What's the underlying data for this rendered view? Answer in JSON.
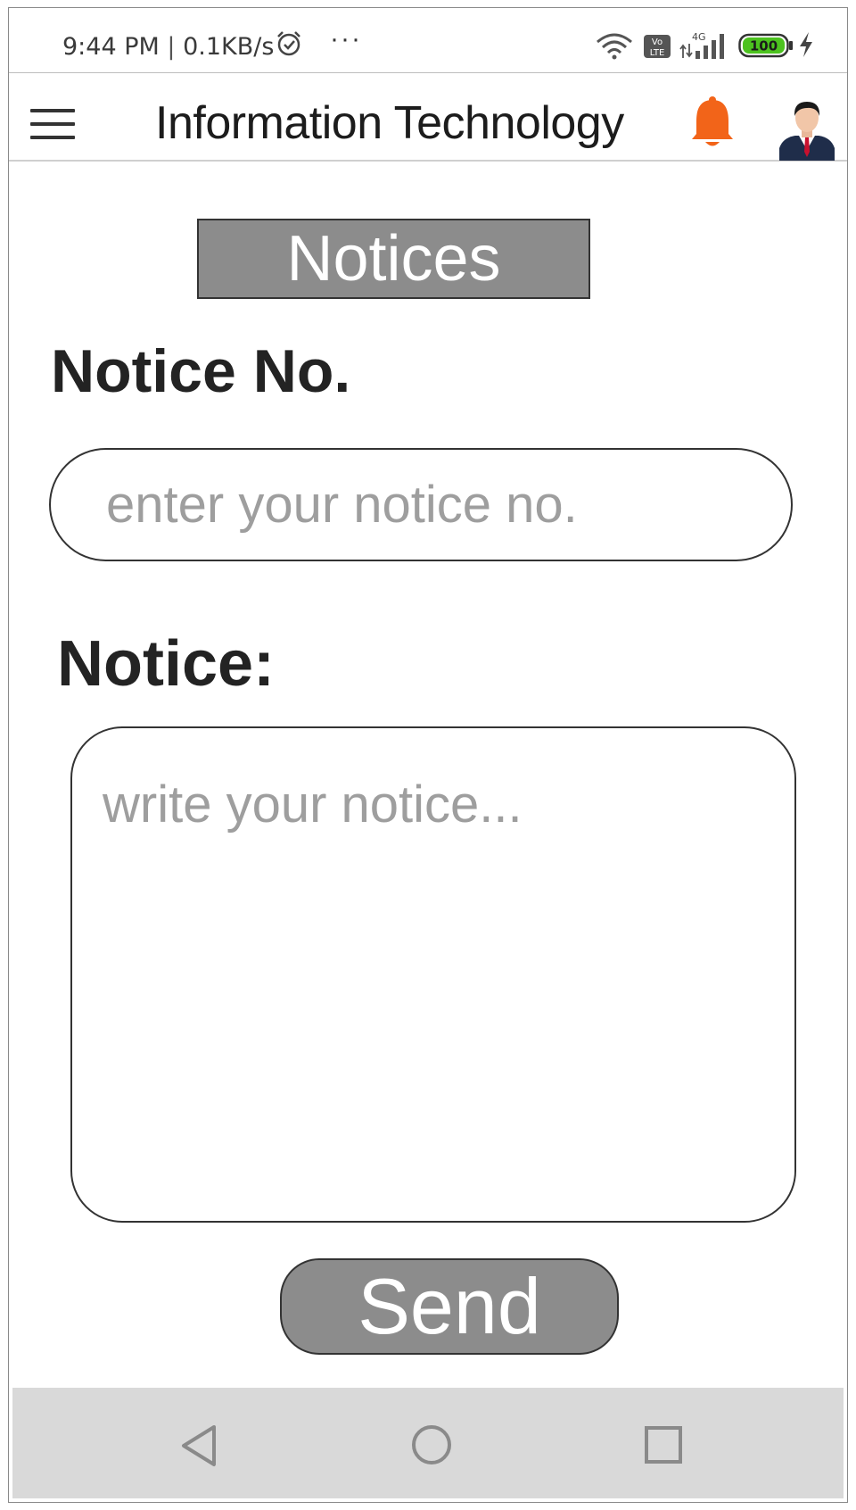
{
  "status_bar": {
    "time": "9:44 PM",
    "separator": "|",
    "speed": "0.1KB/s",
    "more": "···",
    "network": "4G",
    "volte": "Vo LTE",
    "battery": "100"
  },
  "app_bar": {
    "title": "Information Technology"
  },
  "page": {
    "header": "Notices",
    "notice_no_label": "Notice No.",
    "notice_no_placeholder": "enter your notice no.",
    "notice_no_value": "",
    "notice_label": "Notice:",
    "notice_placeholder": "write your notice...",
    "notice_value": "",
    "send_label": "Send"
  },
  "colors": {
    "bell": "#f26419",
    "button_bg": "#8c8c8c",
    "nav_bar": "#d9d9d9",
    "battery_fill": "#4cc21f"
  },
  "icons": {
    "menu": "hamburger-menu-icon",
    "bell": "bell-icon",
    "avatar": "user-avatar",
    "back": "triangle-back-icon",
    "home": "circle-home-icon",
    "recent": "square-recents-icon"
  }
}
